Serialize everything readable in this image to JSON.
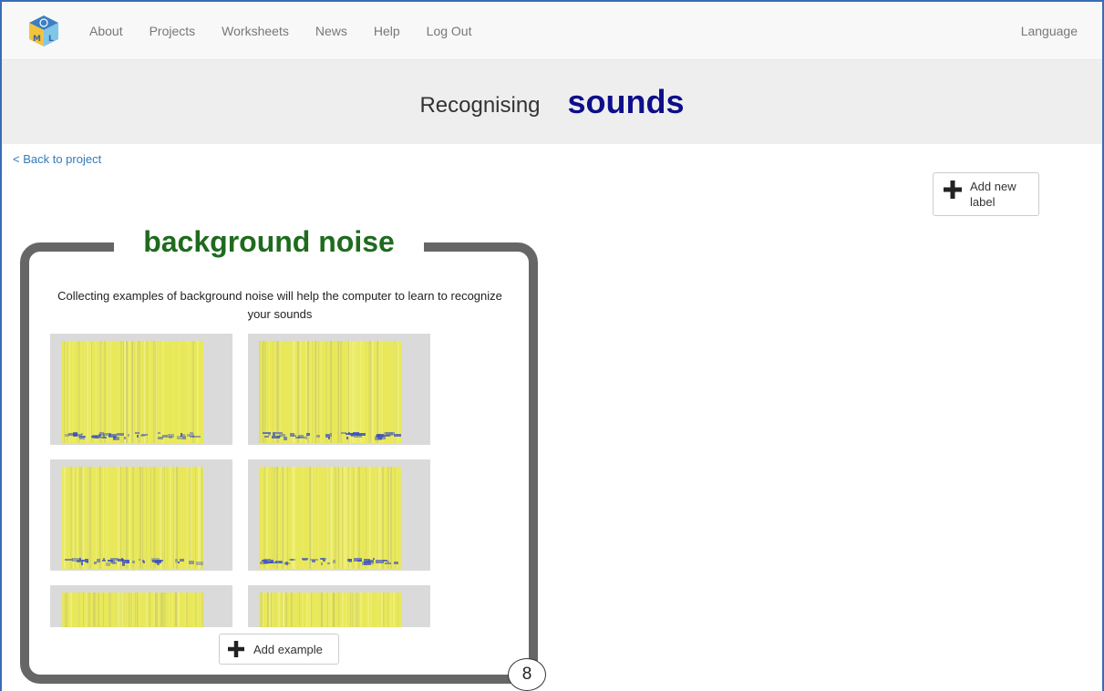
{
  "nav": {
    "items": [
      "About",
      "Projects",
      "Worksheets",
      "News",
      "Help",
      "Log Out"
    ],
    "language": "Language",
    "logo_icon": "ml-cube-logo-icon"
  },
  "header": {
    "prefix": "Recognising",
    "project": "sounds"
  },
  "back_link": "< Back to project",
  "add_label": {
    "label": "Add new label",
    "icon": "plus-icon"
  },
  "label_card": {
    "title": "background noise",
    "description": "Collecting examples of background noise will help the computer to learn to recognize your sounds",
    "add_example_label": "Add example",
    "example_count": "8",
    "colors": {
      "border": "#666666",
      "title": "#1e6b1e"
    }
  },
  "colors": {
    "brand_title": "#0d0e8a",
    "link": "#337ab7",
    "spectrogram_yellow": "#e8e85a",
    "spectrogram_blue": "#3a4fc0"
  }
}
